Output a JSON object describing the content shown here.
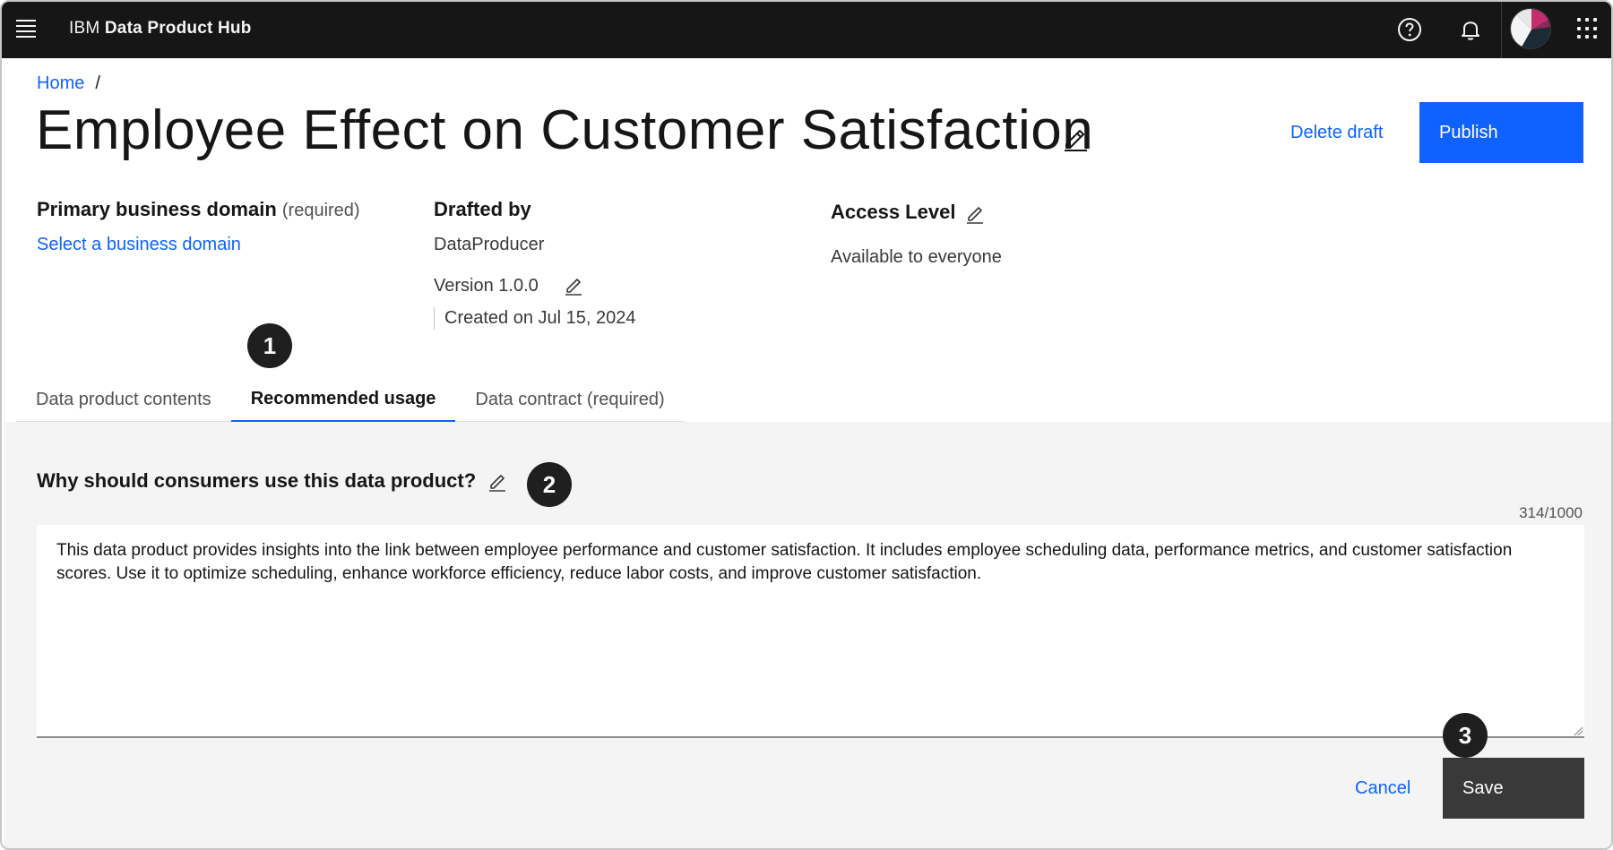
{
  "header": {
    "menu_icon": "hamburger-menu-icon",
    "brand_prefix": "IBM",
    "brand_name": "Data Product Hub",
    "help_icon": "help-icon",
    "notification_icon": "bell-icon",
    "apps_icon": "app-switcher-icon"
  },
  "breadcrumb": {
    "home": "Home",
    "separator": "/"
  },
  "page": {
    "title": "Employee Effect on Customer Satisfaction",
    "delete_label": "Delete draft",
    "publish_label": "Publish"
  },
  "details": {
    "domain_label": "Primary business domain",
    "domain_required": "(required)",
    "domain_link": "Select a business domain",
    "drafted_label": "Drafted by",
    "drafted_value": "DataProducer",
    "version": "Version 1.0.0",
    "created": "Created on Jul 15, 2024",
    "access_label": "Access Level",
    "access_value": "Available to everyone"
  },
  "tabs": [
    {
      "label": "Data product contents",
      "active": false
    },
    {
      "label": "Recommended usage",
      "active": true
    },
    {
      "label": "Data contract (required)",
      "active": false
    }
  ],
  "usage": {
    "question": "Why should consumers use this data product?",
    "counter": "314/1000",
    "text": "This data product provides insights into the link between employee performance and customer satisfaction. It includes employee scheduling data, performance metrics, and customer satisfaction scores. Use it to optimize scheduling, enhance workforce efficiency, reduce labor costs, and improve customer satisfaction.",
    "cancel_label": "Cancel",
    "save_label": "Save"
  },
  "callouts": [
    "1",
    "2",
    "3"
  ],
  "colors": {
    "accent": "#0f62fe",
    "header_bg": "#161616",
    "panel_bg": "#f4f4f4",
    "save_bg": "#393939"
  }
}
